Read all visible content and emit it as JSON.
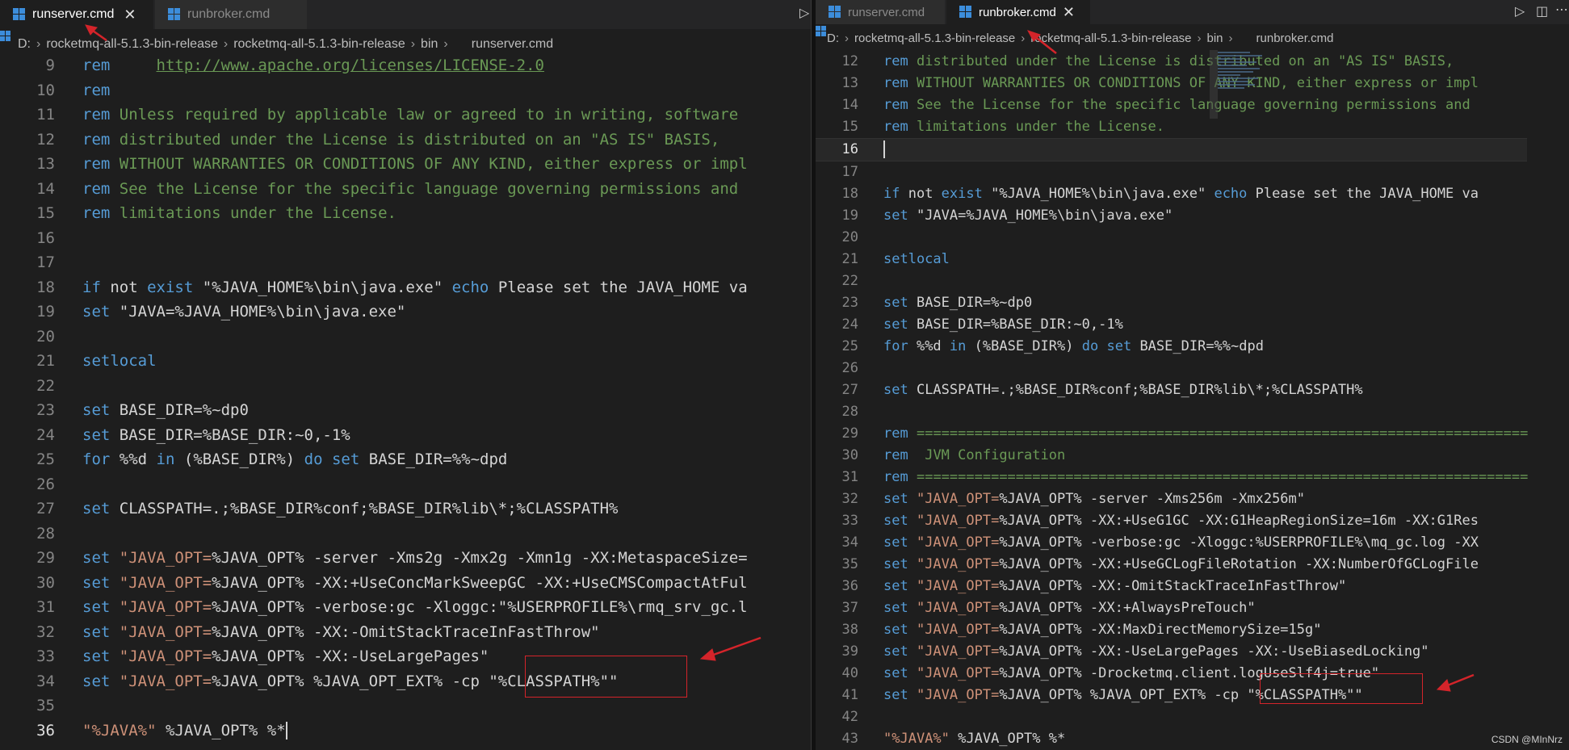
{
  "left": {
    "tabs": [
      {
        "label": "runserver.cmd",
        "active": true,
        "closable": true
      },
      {
        "label": "runbroker.cmd",
        "active": false,
        "closable": false
      }
    ],
    "breadcrumb": [
      "D:",
      "rocketmq-all-5.1.3-bin-release",
      "rocketmq-all-5.1.3-bin-release",
      "bin",
      "runserver.cmd"
    ],
    "current_line": 36,
    "lines": [
      {
        "n": 9,
        "t": "rem     http://www.apache.org/licenses/LICENSE-2.0"
      },
      {
        "n": 10,
        "t": "rem"
      },
      {
        "n": 11,
        "t": "rem Unless required by applicable law or agreed to in writing, software"
      },
      {
        "n": 12,
        "t": "rem distributed under the License is distributed on an \"AS IS\" BASIS,"
      },
      {
        "n": 13,
        "t": "rem WITHOUT WARRANTIES OR CONDITIONS OF ANY KIND, either express or impl"
      },
      {
        "n": 14,
        "t": "rem See the License for the specific language governing permissions and"
      },
      {
        "n": 15,
        "t": "rem limitations under the License."
      },
      {
        "n": 16,
        "t": ""
      },
      {
        "n": 17,
        "t": ""
      },
      {
        "n": 18,
        "t": "if not exist \"%JAVA_HOME%\\bin\\java.exe\" echo Please set the JAVA_HOME va"
      },
      {
        "n": 19,
        "t": "set \"JAVA=%JAVA_HOME%\\bin\\java.exe\""
      },
      {
        "n": 20,
        "t": ""
      },
      {
        "n": 21,
        "t": "setlocal"
      },
      {
        "n": 22,
        "t": ""
      },
      {
        "n": 23,
        "t": "set BASE_DIR=%~dp0"
      },
      {
        "n": 24,
        "t": "set BASE_DIR=%BASE_DIR:~0,-1%"
      },
      {
        "n": 25,
        "t": "for %%d in (%BASE_DIR%) do set BASE_DIR=%%~dpd"
      },
      {
        "n": 26,
        "t": ""
      },
      {
        "n": 27,
        "t": "set CLASSPATH=.;%BASE_DIR%conf;%BASE_DIR%lib\\*;%CLASSPATH%"
      },
      {
        "n": 28,
        "t": ""
      },
      {
        "n": 29,
        "t": "set \"JAVA_OPT=%JAVA_OPT% -server -Xms2g -Xmx2g -Xmn1g -XX:MetaspaceSize="
      },
      {
        "n": 30,
        "t": "set \"JAVA_OPT=%JAVA_OPT% -XX:+UseConcMarkSweepGC -XX:+UseCMSCompactAtFul"
      },
      {
        "n": 31,
        "t": "set \"JAVA_OPT=%JAVA_OPT% -verbose:gc -Xloggc:\"%USERPROFILE%\\rmq_srv_gc.l"
      },
      {
        "n": 32,
        "t": "set \"JAVA_OPT=%JAVA_OPT% -XX:-OmitStackTraceInFastThrow\""
      },
      {
        "n": 33,
        "t": "set \"JAVA_OPT=%JAVA_OPT% -XX:-UseLargePages\""
      },
      {
        "n": 34,
        "t": "set \"JAVA_OPT=%JAVA_OPT% %JAVA_OPT_EXT% -cp \"%CLASSPATH%\"\""
      },
      {
        "n": 35,
        "t": ""
      },
      {
        "n": 36,
        "t": "\"%JAVA%\" %JAVA_OPT% %*"
      }
    ]
  },
  "right": {
    "tabs": [
      {
        "label": "runserver.cmd",
        "active": false,
        "closable": false
      },
      {
        "label": "runbroker.cmd",
        "active": true,
        "closable": true
      }
    ],
    "breadcrumb": [
      "D:",
      "rocketmq-all-5.1.3-bin-release",
      "rocketmq-all-5.1.3-bin-release",
      "bin",
      "runbroker.cmd"
    ],
    "current_line": 16,
    "lines": [
      {
        "n": 12,
        "t": "rem distributed under the License is distributed on an \"AS IS\" BASIS,"
      },
      {
        "n": 13,
        "t": "rem WITHOUT WARRANTIES OR CONDITIONS OF ANY KIND, either express or impl"
      },
      {
        "n": 14,
        "t": "rem See the License for the specific language governing permissions and"
      },
      {
        "n": 15,
        "t": "rem limitations under the License."
      },
      {
        "n": 16,
        "t": ""
      },
      {
        "n": 17,
        "t": ""
      },
      {
        "n": 18,
        "t": "if not exist \"%JAVA_HOME%\\bin\\java.exe\" echo Please set the JAVA_HOME va"
      },
      {
        "n": 19,
        "t": "set \"JAVA=%JAVA_HOME%\\bin\\java.exe\""
      },
      {
        "n": 20,
        "t": ""
      },
      {
        "n": 21,
        "t": "setlocal"
      },
      {
        "n": 22,
        "t": ""
      },
      {
        "n": 23,
        "t": "set BASE_DIR=%~dp0"
      },
      {
        "n": 24,
        "t": "set BASE_DIR=%BASE_DIR:~0,-1%"
      },
      {
        "n": 25,
        "t": "for %%d in (%BASE_DIR%) do set BASE_DIR=%%~dpd"
      },
      {
        "n": 26,
        "t": ""
      },
      {
        "n": 27,
        "t": "set CLASSPATH=.;%BASE_DIR%conf;%BASE_DIR%lib\\*;%CLASSPATH%"
      },
      {
        "n": 28,
        "t": ""
      },
      {
        "n": 29,
        "t": "rem =========================================================================="
      },
      {
        "n": 30,
        "t": "rem  JVM Configuration"
      },
      {
        "n": 31,
        "t": "rem =========================================================================="
      },
      {
        "n": 32,
        "t": "set \"JAVA_OPT=%JAVA_OPT% -server -Xms256m -Xmx256m\""
      },
      {
        "n": 33,
        "t": "set \"JAVA_OPT=%JAVA_OPT% -XX:+UseG1GC -XX:G1HeapRegionSize=16m -XX:G1Res"
      },
      {
        "n": 34,
        "t": "set \"JAVA_OPT=%JAVA_OPT% -verbose:gc -Xloggc:%USERPROFILE%\\mq_gc.log -XX"
      },
      {
        "n": 35,
        "t": "set \"JAVA_OPT=%JAVA_OPT% -XX:+UseGCLogFileRotation -XX:NumberOfGCLogFile"
      },
      {
        "n": 36,
        "t": "set \"JAVA_OPT=%JAVA_OPT% -XX:-OmitStackTraceInFastThrow\""
      },
      {
        "n": 37,
        "t": "set \"JAVA_OPT=%JAVA_OPT% -XX:+AlwaysPreTouch\""
      },
      {
        "n": 38,
        "t": "set \"JAVA_OPT=%JAVA_OPT% -XX:MaxDirectMemorySize=15g\""
      },
      {
        "n": 39,
        "t": "set \"JAVA_OPT=%JAVA_OPT% -XX:-UseLargePages -XX:-UseBiasedLocking\""
      },
      {
        "n": 40,
        "t": "set \"JAVA_OPT=%JAVA_OPT% -Drocketmq.client.logUseSlf4j=true\""
      },
      {
        "n": 41,
        "t": "set \"JAVA_OPT=%JAVA_OPT% %JAVA_OPT_EXT% -cp \"%CLASSPATH%\"\""
      },
      {
        "n": 42,
        "t": ""
      },
      {
        "n": 43,
        "t": "\"%JAVA%\" %JAVA_OPT% %*"
      }
    ]
  },
  "watermark": "CSDN @MInNrz",
  "colors": {
    "keyword": "#569cd6",
    "comment": "#6a9955",
    "string": "#ce9178",
    "annotation": "#d4242a",
    "file_icon": "#3c8ddb"
  },
  "icons": {
    "file": "windows-file-icon",
    "close": "close-icon",
    "run": "run-icon",
    "split": "split-editor-icon",
    "more": "more-actions-icon"
  }
}
